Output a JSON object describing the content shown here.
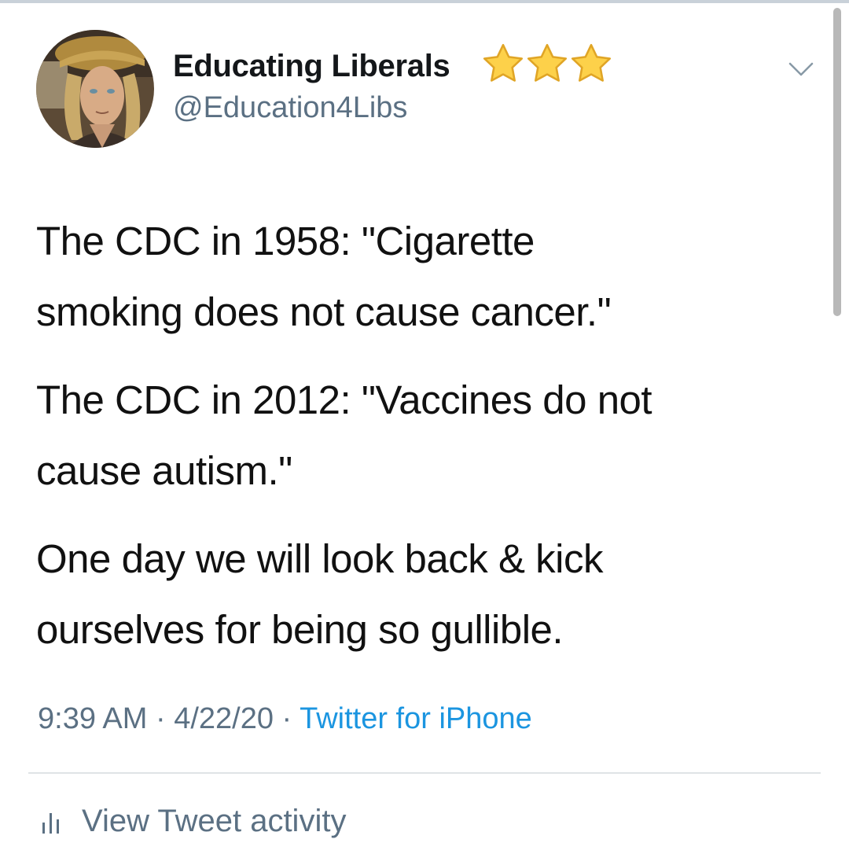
{
  "tweet": {
    "author": {
      "display_name": "Educating Liberals",
      "handle": "@Education4Libs",
      "badge_icons": [
        "star-icon",
        "star-icon",
        "star-icon"
      ],
      "avatar_icon": "avatar"
    },
    "paragraphs": [
      "The CDC in 1958: \"Cigarette\nsmoking does not cause cancer.\"",
      "The CDC in 2012: \"Vaccines do not\ncause autism.\"",
      "One day we will look back & kick\nourselves for being so gullible."
    ],
    "time": "9:39 AM",
    "separator": " · ",
    "date": "4/22/20",
    "source": "Twitter for iPhone",
    "activity_label": "View Tweet activity",
    "icons": {
      "menu": "chevron-down-icon",
      "activity": "bar-chart-icon"
    }
  },
  "colors": {
    "text": "#111111",
    "secondary": "#5b7083",
    "link": "#1b95e0",
    "divider": "#dfe3e6",
    "star": "#fdd14a"
  }
}
